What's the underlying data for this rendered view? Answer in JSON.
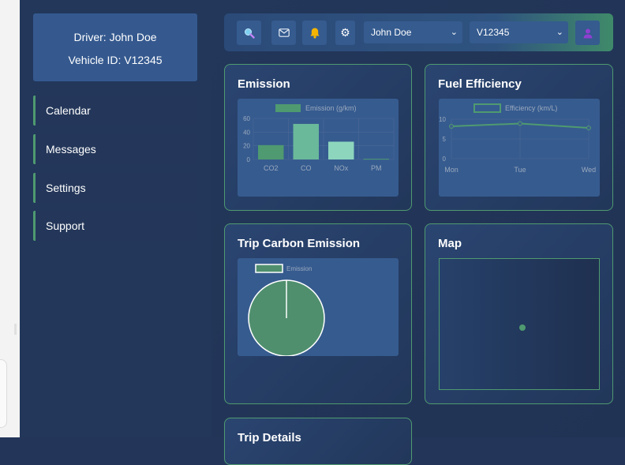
{
  "driver": {
    "driver_line": "Driver: John Doe",
    "vehicle_line": "Vehicle ID: V12345"
  },
  "sidebar": {
    "items": [
      {
        "label": "Calendar"
      },
      {
        "label": "Messages"
      },
      {
        "label": "Settings"
      },
      {
        "label": "Support"
      }
    ]
  },
  "topbar": {
    "icons": [
      "search-icon",
      "mail-icon",
      "bell-icon",
      "gear-icon",
      "user-icon"
    ],
    "driver_select": "John Doe",
    "vehicle_select": "V12345"
  },
  "cards": {
    "emission": "Emission",
    "fuel": "Fuel Efficiency",
    "trip_carbon": "Trip Carbon Emission",
    "map": "Map",
    "trip_details": "Trip Details"
  },
  "colors": {
    "accent": "#4f9a70",
    "panel": "#365b8f",
    "background": "#22375a"
  },
  "chart_data": [
    {
      "type": "bar",
      "legend": "Emission (g/km)",
      "categories": [
        "CO2",
        "CO",
        "NOx",
        "PM"
      ],
      "values": [
        21,
        52,
        26,
        1
      ],
      "colors": [
        "#4f9a70",
        "#6ab99a",
        "#8dd6bd",
        "#4f9a70"
      ],
      "yticks": [
        0,
        20,
        40,
        60
      ],
      "ylim": [
        0,
        60
      ],
      "grid": true,
      "legend_position": "top"
    },
    {
      "type": "line",
      "legend": "Efficiency (km/L)",
      "categories": [
        "Mon",
        "Tue",
        "Wed"
      ],
      "values": [
        8.2,
        8.9,
        7.8
      ],
      "yticks": [
        0,
        5,
        10
      ],
      "ylim": [
        0,
        10
      ],
      "grid": true,
      "legend_position": "top"
    },
    {
      "type": "pie",
      "legend": "Emission",
      "values": [
        100
      ],
      "colors": [
        "#4f8f6e"
      ],
      "legend_position": "top"
    }
  ]
}
